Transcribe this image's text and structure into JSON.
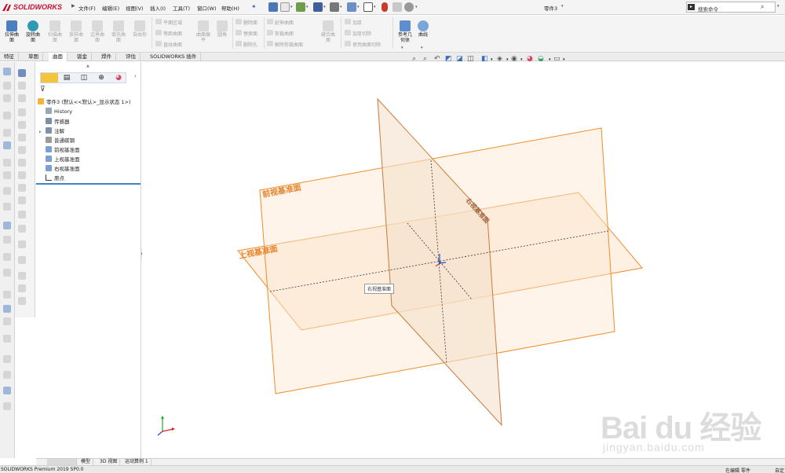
{
  "app": {
    "logo_text": "SOLIDWORKS",
    "document_title": "零件3",
    "colors": {
      "brand_red": "#c8102e",
      "plane_orange": "#f28c28",
      "plane_label": "#e8832a",
      "accent_blue": "#3b84c8"
    }
  },
  "menu": [
    {
      "label": "文件(F)"
    },
    {
      "label": "编辑(E)"
    },
    {
      "label": "视图(V)"
    },
    {
      "label": "插入(I)"
    },
    {
      "label": "工具(T)"
    },
    {
      "label": "窗口(W)"
    },
    {
      "label": "帮助(H)"
    }
  ],
  "search": {
    "placeholder": "搜索命令"
  },
  "ribbon": {
    "large": [
      {
        "label_line1": "拉伸曲",
        "label_line2": "面",
        "enabled": true,
        "icon": "extruded-surface-icon"
      },
      {
        "label_line1": "旋转曲",
        "label_line2": "面",
        "enabled": true,
        "icon": "revolved-surface-icon"
      },
      {
        "label_line1": "扫描曲",
        "label_line2": "面",
        "enabled": false,
        "icon": "swept-surface-icon"
      },
      {
        "label_line1": "放样曲",
        "label_line2": "面",
        "enabled": false,
        "icon": "lofted-surface-icon"
      },
      {
        "label_line1": "边界曲",
        "label_line2": "面",
        "enabled": false,
        "icon": "boundary-surface-icon"
      },
      {
        "label_line1": "填充曲",
        "label_line2": "面",
        "enabled": false,
        "icon": "filled-surface-icon"
      },
      {
        "label_line1": "自由形",
        "label_line2": "",
        "enabled": false,
        "icon": "freeform-icon"
      }
    ],
    "group1": [
      "平面区域",
      "等距曲面",
      "直纹曲面"
    ],
    "group1_large": [
      {
        "label_line1": "曲面展",
        "label_line2": "平",
        "icon": "flatten-surface-icon"
      },
      {
        "label_line1": "圆角",
        "label_line2": "",
        "icon": "fillet-icon"
      }
    ],
    "group2": [
      "删除面",
      "替换面",
      "删除孔"
    ],
    "group3": [
      "延伸曲面",
      "剪裁曲面",
      "解除剪裁曲面"
    ],
    "group3_large": {
      "label_line1": "缝合曲",
      "label_line2": "面"
    },
    "group4": [
      "加厚",
      "加厚切除",
      "使用曲面切除"
    ],
    "enabled_large": [
      {
        "label_line1": "参考几",
        "label_line2": "何体",
        "icon": "reference-geometry-icon"
      },
      {
        "label_line1": "曲线",
        "label_line2": "",
        "icon": "curves-icon"
      }
    ]
  },
  "command_tabs": [
    {
      "label": "特征",
      "active": false
    },
    {
      "label": "草图",
      "active": false
    },
    {
      "label": "曲面",
      "active": true
    },
    {
      "label": "钣金",
      "active": false
    },
    {
      "label": "焊件",
      "active": false
    },
    {
      "label": "评估",
      "active": false
    },
    {
      "label": "SOLIDWORKS 插件",
      "active": false
    }
  ],
  "feature_tree": {
    "root": "零件3 (默认<<默认>_显示状态 1>)",
    "items": [
      {
        "label": "History",
        "icon": "history-icon"
      },
      {
        "label": "传感器",
        "icon": "sensor-icon"
      },
      {
        "label": "注解",
        "icon": "annotations-icon"
      },
      {
        "label": "普通碳钢",
        "icon": "material-icon"
      },
      {
        "label": "前视基准面",
        "icon": "plane-icon"
      },
      {
        "label": "上视基准面",
        "icon": "plane-icon"
      },
      {
        "label": "右视基准面",
        "icon": "plane-icon"
      },
      {
        "label": "原点",
        "icon": "origin-icon"
      }
    ]
  },
  "viewport": {
    "plane_labels": {
      "front": "前视基准面",
      "top": "上视基准面",
      "right": "右视基准面"
    },
    "tooltip": "右视基准面",
    "watermark_main": "Bai du 经验",
    "watermark_sub": "jingyan.baidu.com"
  },
  "bottom_tabs": [
    {
      "label": "模型"
    },
    {
      "label": "3D 视图"
    },
    {
      "label": "运动算例 1"
    }
  ],
  "status": {
    "left": "SOLIDWORKS Premium 2019 SP0.0",
    "editing": "在编辑 零件",
    "right": "自定"
  }
}
